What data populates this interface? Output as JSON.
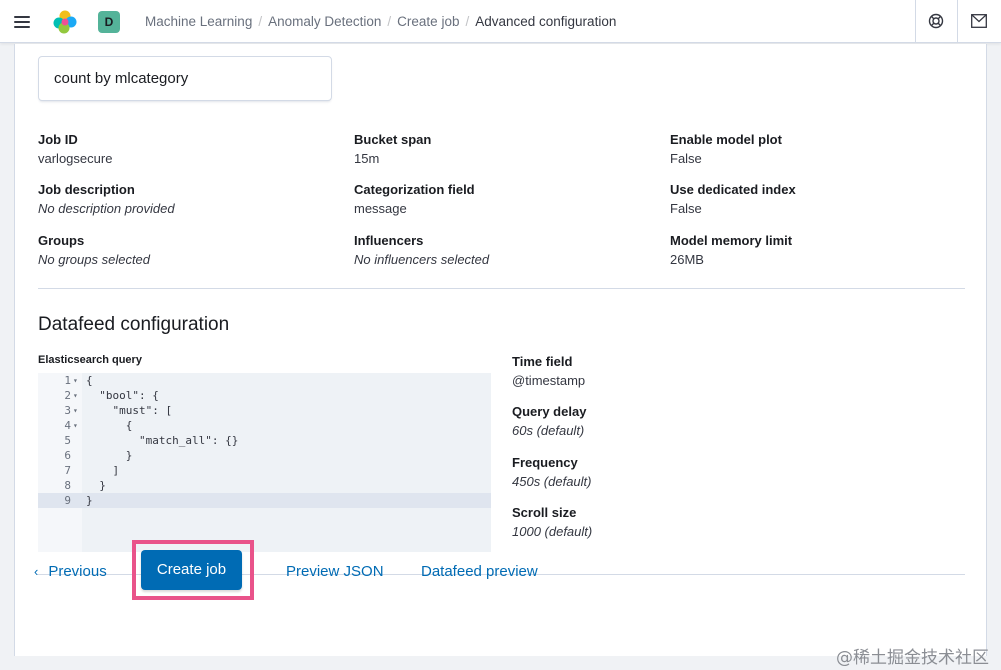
{
  "header": {
    "space_initial": "D",
    "breadcrumbs": [
      "Machine Learning",
      "Anomaly Detection",
      "Create job"
    ],
    "current": "Advanced configuration"
  },
  "detector": {
    "label": "count by mlcategory"
  },
  "summary": {
    "job_id": {
      "label": "Job ID",
      "value": "varlogsecure"
    },
    "job_description": {
      "label": "Job description",
      "value": "No description provided"
    },
    "groups": {
      "label": "Groups",
      "value": "No groups selected"
    },
    "bucket_span": {
      "label": "Bucket span",
      "value": "15m"
    },
    "categorization_field": {
      "label": "Categorization field",
      "value": "message"
    },
    "influencers": {
      "label": "Influencers",
      "value": "No influencers selected"
    },
    "enable_model_plot": {
      "label": "Enable model plot",
      "value": "False"
    },
    "use_dedicated_index": {
      "label": "Use dedicated index",
      "value": "False"
    },
    "model_memory_limit": {
      "label": "Model memory limit",
      "value": "26MB"
    }
  },
  "datafeed": {
    "title": "Datafeed configuration",
    "query_label": "Elasticsearch query",
    "code_lines": [
      {
        "num": "1",
        "fold": true,
        "text": "{"
      },
      {
        "num": "2",
        "fold": true,
        "text": "  \"bool\": {"
      },
      {
        "num": "3",
        "fold": true,
        "text": "    \"must\": ["
      },
      {
        "num": "4",
        "fold": true,
        "text": "      {"
      },
      {
        "num": "5",
        "fold": false,
        "text": "        \"match_all\": {}"
      },
      {
        "num": "6",
        "fold": false,
        "text": "      }"
      },
      {
        "num": "7",
        "fold": false,
        "text": "    ]"
      },
      {
        "num": "8",
        "fold": false,
        "text": "  }"
      },
      {
        "num": "9",
        "fold": false,
        "text": "}"
      }
    ],
    "time_field": {
      "label": "Time field",
      "value": "@timestamp"
    },
    "query_delay": {
      "label": "Query delay",
      "value": "60s (default)"
    },
    "frequency": {
      "label": "Frequency",
      "value": "450s (default)"
    },
    "scroll_size": {
      "label": "Scroll size",
      "value": "1000 (default)"
    }
  },
  "actions": {
    "previous": "Previous",
    "create_job": "Create job",
    "preview_json": "Preview JSON",
    "datafeed_preview": "Datafeed preview"
  },
  "watermark": "@稀土掘金技术社区",
  "colors": {
    "primary": "#006bb4",
    "highlight": "#e9538a",
    "space_badge": "#54b399"
  },
  "icons": [
    "menu-icon",
    "elastic-logo",
    "help-icon",
    "mail-icon",
    "chevron-left-icon",
    "fold-arrow-icon"
  ]
}
